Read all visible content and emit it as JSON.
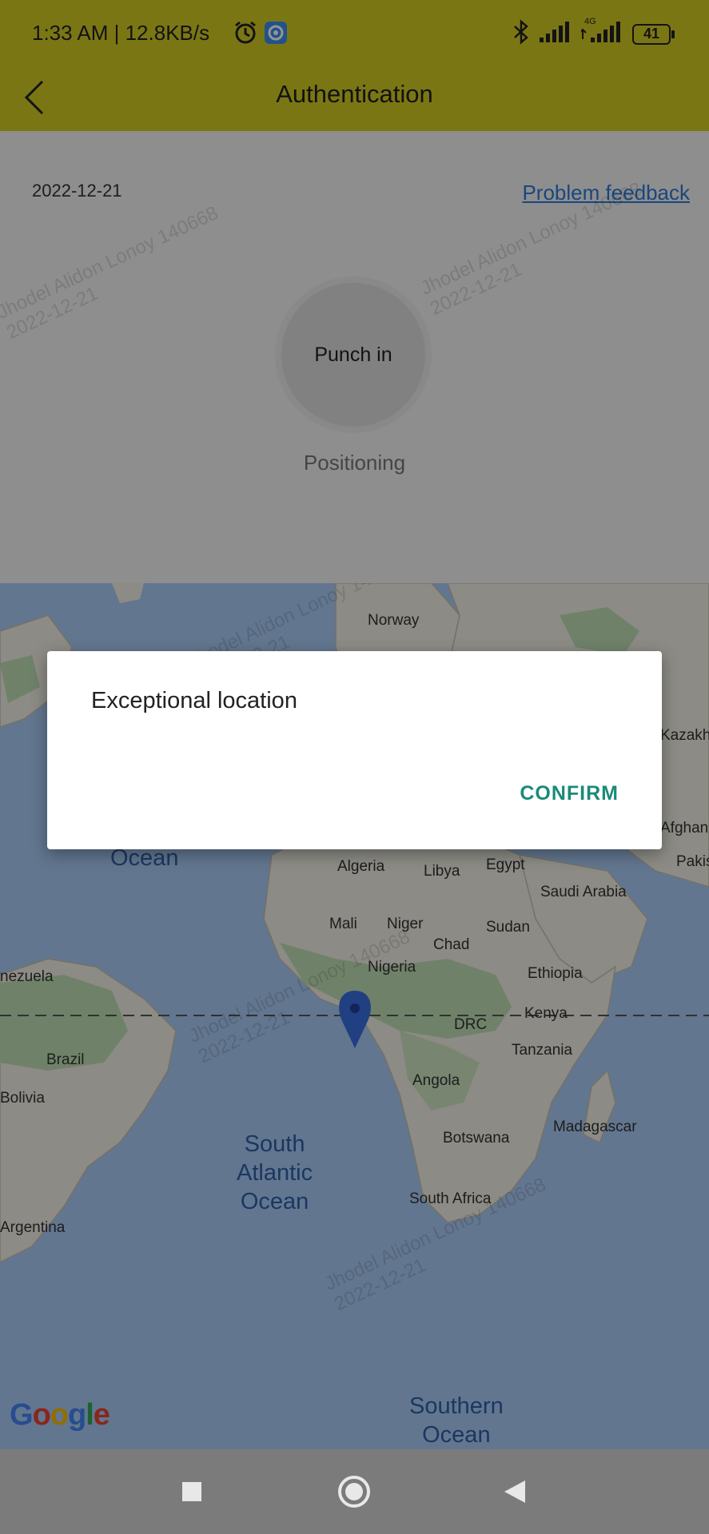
{
  "status_bar": {
    "time_speed": "1:33 AM | 12.8KB/s",
    "network": "4G",
    "battery": "41"
  },
  "app_bar": {
    "title": "Authentication"
  },
  "punch": {
    "date": "2022-12-21",
    "feedback_link": "Problem feedback",
    "button_label": "Punch in",
    "status": "Positioning"
  },
  "map": {
    "labels": [
      "Norway",
      "Kazakh",
      "Afghan",
      "Pakis",
      "Algeria",
      "Libya",
      "Egypt",
      "Saudi Arabia",
      "Mali",
      "Niger",
      "Chad",
      "Sudan",
      "Nigeria",
      "Ethiopia",
      "Kenya",
      "DRC",
      "Tanzania",
      "Angola",
      "Madagascar",
      "Botswana",
      "South Africa",
      "nezuela",
      "Brazil",
      "Bolivia",
      "Argentina"
    ],
    "oceans": [
      "Ocean",
      "South\nAtlantic\nOcean",
      "Southern\nOcean"
    ],
    "provider": "Google"
  },
  "watermark": {
    "text": "Jhodel Alidon Lonoy  140668\n2022-12-21"
  },
  "dialog": {
    "title": "Exceptional location",
    "confirm_label": "CONFIRM"
  },
  "colors": {
    "app_bar": "#d4cc24",
    "link": "#2b7bd8",
    "dialog_button": "#1b8a78",
    "ocean": "#aacbf6",
    "land": "#f2efe6",
    "marker": "#3a6fe0"
  }
}
